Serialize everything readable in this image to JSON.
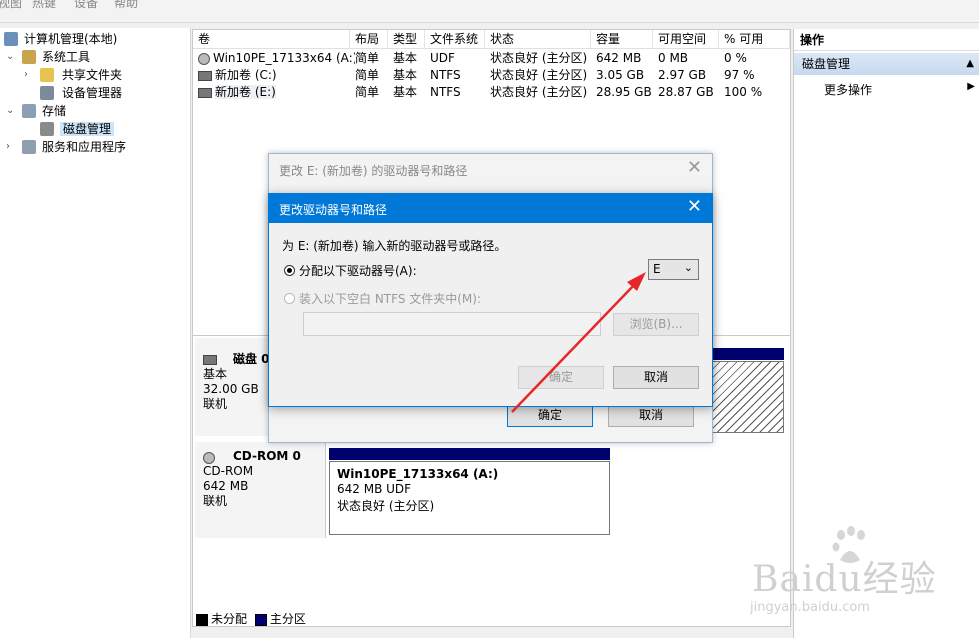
{
  "menubar": {
    "items": [
      "视图",
      "热键",
      "设备",
      "帮助"
    ]
  },
  "tree": {
    "root": "计算机管理(本地)",
    "system_tools": "系统工具",
    "shared_folders": "共享文件夹",
    "device_manager": "设备管理器",
    "storage": "存储",
    "disk_management": "磁盘管理",
    "services": "服务和应用程序"
  },
  "volume_list": {
    "headers": [
      "卷",
      "布局",
      "类型",
      "文件系统",
      "状态",
      "容量",
      "可用空间",
      "% 可用"
    ],
    "rows": [
      {
        "name": "Win10PE_17133x64 (A:)",
        "layout": "简单",
        "type": "基本",
        "fs": "UDF",
        "status": "状态良好 (主分区)",
        "capacity": "642 MB",
        "free": "0 MB",
        "pct": "0 %"
      },
      {
        "name": "新加卷 (C:)",
        "layout": "简单",
        "type": "基本",
        "fs": "NTFS",
        "status": "状态良好 (主分区)",
        "capacity": "3.05 GB",
        "free": "2.97 GB",
        "pct": "97 %"
      },
      {
        "name": "新加卷 (E:)",
        "layout": "简单",
        "type": "基本",
        "fs": "NTFS",
        "status": "状态良好 (主分区)",
        "capacity": "28.95 GB",
        "free": "28.87 GB",
        "pct": "100 %"
      }
    ]
  },
  "disk0": {
    "name": "磁盘 0",
    "type": "基本",
    "size": "32.00 GB",
    "status": "联机"
  },
  "cdrom0": {
    "name": "CD-ROM 0",
    "type": "CD-ROM",
    "size": "642 MB",
    "status": "联机",
    "volume_name": "Win10PE_17133x64  (A:)",
    "volume_size": "642 MB UDF",
    "volume_status": "状态良好 (主分区)"
  },
  "legend": {
    "unallocated": "未分配",
    "primary": "主分区"
  },
  "actions": {
    "header": "操作",
    "section": "磁盘管理",
    "more": "更多操作"
  },
  "dialog_back": {
    "title": "更改 E: (新加卷) 的驱动器号和路径",
    "ok": "确定",
    "cancel": "取消"
  },
  "dialog_front": {
    "title": "更改驱动器号和路径",
    "prompt": "为 E: (新加卷) 输入新的驱动器号或路径。",
    "assign_letter": "分配以下驱动器号(A):",
    "letter_value": "E",
    "mount_folder": "装入以下空白 NTFS 文件夹中(M):",
    "browse": "浏览(B)...",
    "ok": "确定",
    "cancel": "取消"
  },
  "watermark": {
    "brand": "Baidu经验",
    "url": "jingyan.baidu.com"
  },
  "colors": {
    "accent": "#0078d7",
    "primary_partition": "#00006e",
    "arrow": "#e8262a"
  }
}
